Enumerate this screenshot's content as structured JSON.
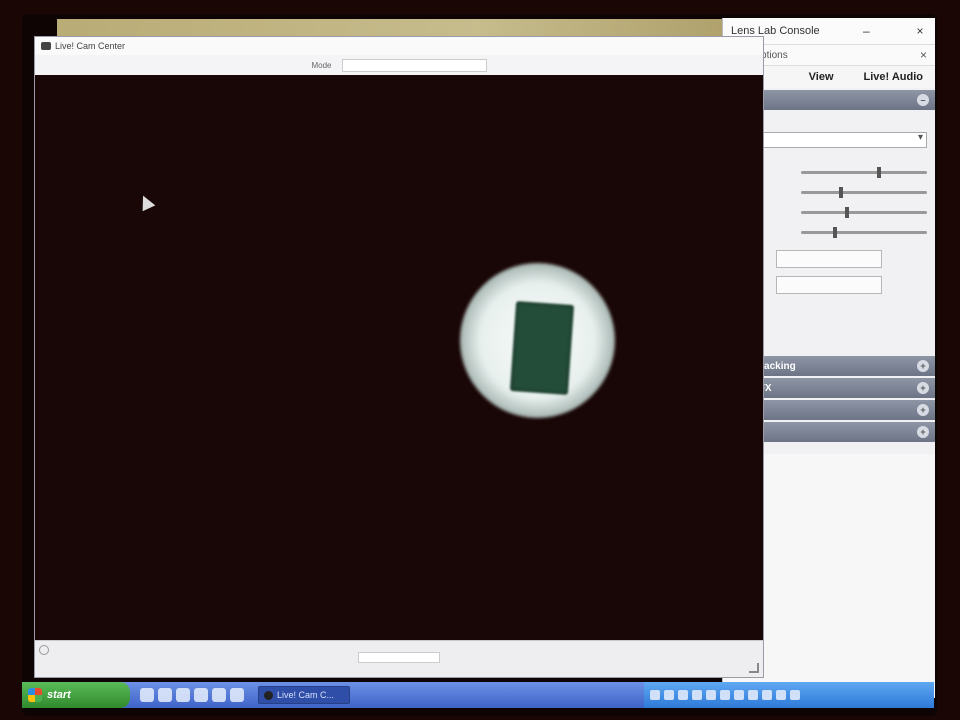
{
  "console": {
    "title": "Lens Lab Console",
    "subtitle": "Lens options",
    "tabs": [
      "View",
      "Live! Audio"
    ],
    "sections": [
      {
        "label": "",
        "expanded": true
      },
      {
        "label": "Face Tracking",
        "expanded": false
      },
      {
        "label": "Video FX",
        "expanded": false
      },
      {
        "label": "",
        "expanded": false
      },
      {
        "label": "",
        "expanded": false
      }
    ],
    "panel": {
      "select_value": "",
      "slider_caption": "",
      "sliders": [
        {
          "label": "",
          "level": 0.6
        },
        {
          "label": "",
          "level": 0.3
        },
        {
          "label": "",
          "level": 0.35
        },
        {
          "label": "",
          "level": 0.25
        }
      ],
      "mode_label": "",
      "button_1": "",
      "button_2": ""
    }
  },
  "webcam": {
    "title": "Live! Cam Center",
    "toolbar_label": "Mode",
    "mode_value": "",
    "status_text": ""
  },
  "taskbar": {
    "start_label": "start",
    "task_item": "Live! Cam C...",
    "clock": ""
  },
  "colors": {
    "taskbar_blue": "#3e63c8",
    "start_green": "#3a9a37",
    "video_bg": "#190606",
    "section_header": "#7a8295",
    "chip_green": "#244d39"
  },
  "icons": [
    "camera-icon",
    "close-icon",
    "mouse-cursor-icon",
    "windows-flag-icon",
    "resize-grip-icon"
  ]
}
